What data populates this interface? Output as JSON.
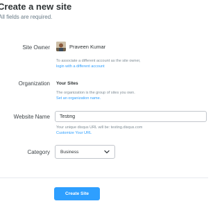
{
  "header": {
    "title": "Create a new site",
    "subtitle": "All fields are required."
  },
  "owner": {
    "label": "Site Owner",
    "name": "Praveen Kumar",
    "help_text": "To associate a different account as the site owner,",
    "help_link": "login with a different account"
  },
  "organization": {
    "label": "Organization",
    "value": "Your Sites",
    "help_text": "The organization is the group of sites you own.",
    "help_link": "Set an organization name."
  },
  "website_name": {
    "label": "Website Name",
    "value": "Testing",
    "help_text": "Your unique disqus URL will be: testing.disqus.com",
    "help_link": "Customize Your URL"
  },
  "category": {
    "label": "Category",
    "selected": "Business",
    "icon": "chevron-down-icon"
  },
  "submit": {
    "label": "Create Site"
  },
  "colors": {
    "accent": "#2e9fff",
    "text": "#3f4549",
    "muted": "#7f8c95",
    "border": "#c2c6cc"
  }
}
